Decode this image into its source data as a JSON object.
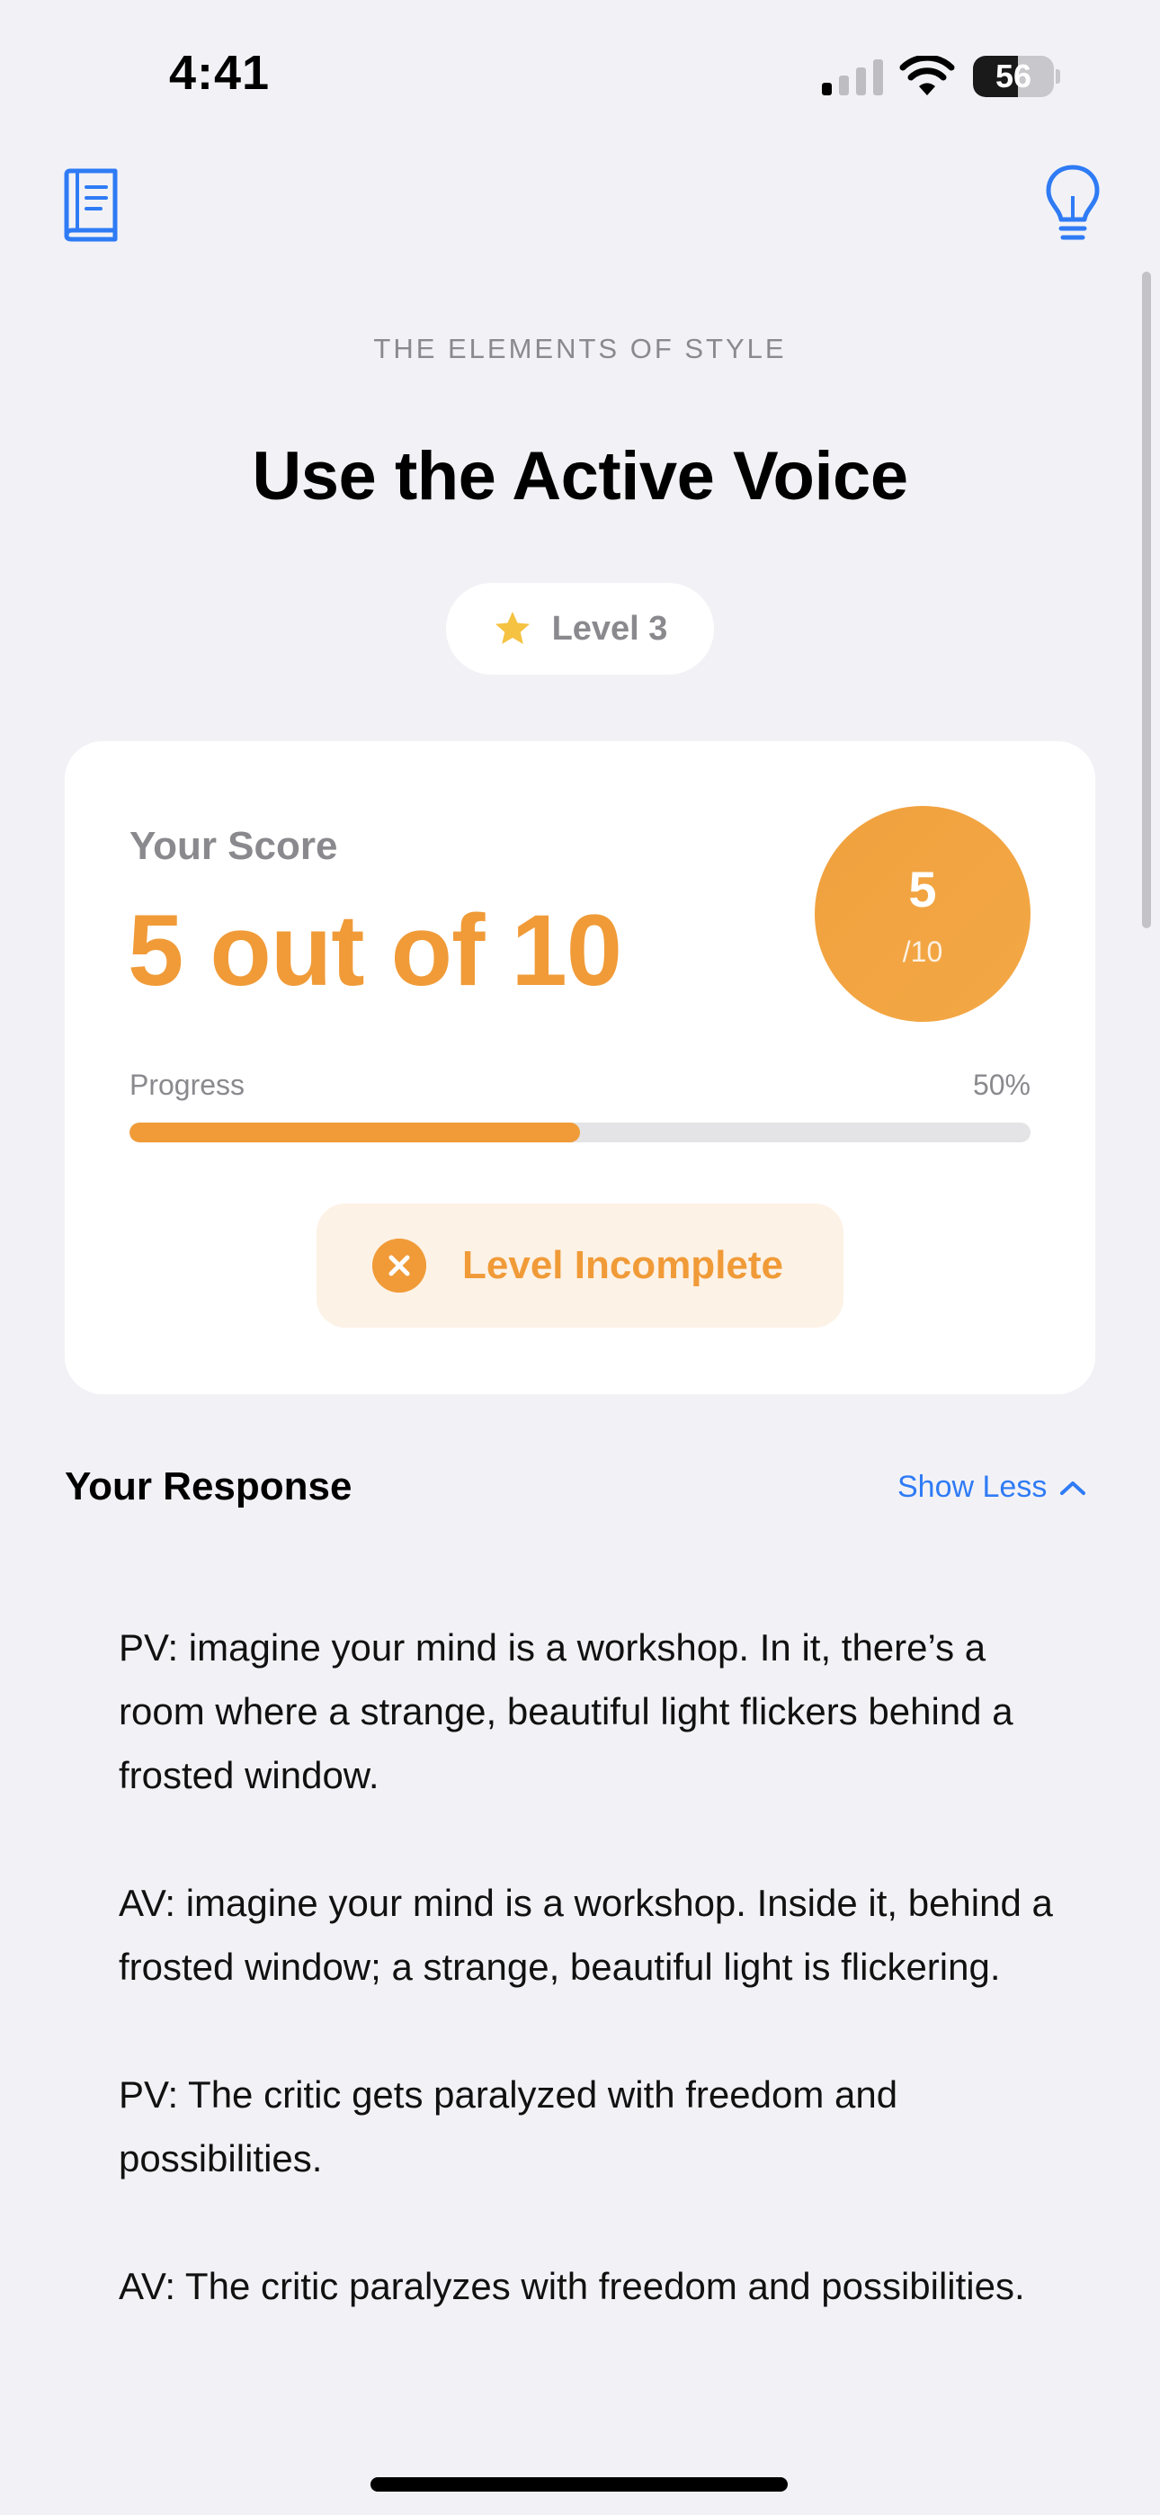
{
  "status_bar": {
    "time": "4:41",
    "battery_level": "56",
    "battery_fraction": 0.56
  },
  "nav": {
    "left_icon": "book-icon",
    "right_icon": "lightbulb-icon"
  },
  "header": {
    "subtitle": "THE ELEMENTS OF STYLE",
    "title": "Use the Active Voice",
    "level_label": "Level 3",
    "level_icon": "star-icon"
  },
  "score_card": {
    "label": "Your Score",
    "value": "5 out of 10",
    "circle_number": "5",
    "circle_denominator": "/10",
    "progress_label": "Progress",
    "progress_percent_text": "50%",
    "progress_fraction": 0.5,
    "status_text": "Level Incomplete",
    "status_icon": "x-circle-icon"
  },
  "response": {
    "heading": "Your Response",
    "toggle_label": "Show Less",
    "paragraphs": [
      "PV: imagine your mind is a workshop. In it, there’s a room where a strange, beautiful light flickers behind a frosted window.",
      "AV: imagine your mind is a workshop. Inside it, behind a frosted window; a strange, beautiful light is flickering.",
      "PV: The critic gets paralyzed with freedom and possibilities.",
      "AV: The critic paralyzes with freedom and possibilities."
    ]
  },
  "colors": {
    "accent_orange": "#f09b38",
    "link_blue": "#2f7bf5",
    "background": "#f2f2f6",
    "chip_background": "#fdf2e6",
    "star_yellow": "#f5c242"
  }
}
